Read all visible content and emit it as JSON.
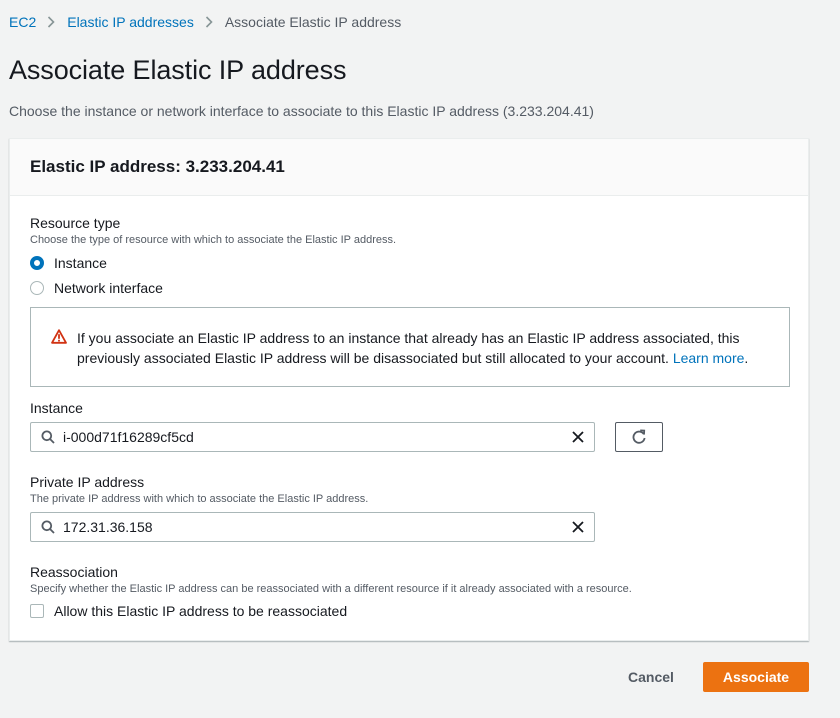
{
  "breadcrumb": {
    "items": [
      "EC2",
      "Elastic IP addresses"
    ],
    "current": "Associate Elastic IP address"
  },
  "page": {
    "title": "Associate Elastic IP address",
    "description": "Choose the instance or network interface to associate to this Elastic IP address (3.233.204.41)"
  },
  "panel": {
    "title": "Elastic IP address: 3.233.204.41"
  },
  "resource_type": {
    "label": "Resource type",
    "description": "Choose the type of resource with which to associate the Elastic IP address.",
    "options": [
      "Instance",
      "Network interface"
    ],
    "selected": "Instance"
  },
  "alert": {
    "text": "If you associate an Elastic IP address to an instance that already has an Elastic IP address associated, this previously associated Elastic IP address will be disassociated but still allocated to your account.",
    "link": "Learn more",
    "trailing": "."
  },
  "instance": {
    "label": "Instance",
    "value": "i-000d71f16289cf5cd"
  },
  "private_ip": {
    "label": "Private IP address",
    "description": "The private IP address with which to associate the Elastic IP address.",
    "value": "172.31.36.158"
  },
  "reassociation": {
    "label": "Reassociation",
    "description": "Specify whether the Elastic IP address can be reassociated with a different resource if it already associated with a resource.",
    "checkbox_label": "Allow this Elastic IP address to be reassociated",
    "checked": false
  },
  "actions": {
    "cancel": "Cancel",
    "associate": "Associate"
  },
  "colors": {
    "link": "#0073bb",
    "primary_button": "#ec7211",
    "warning_icon": "#d13212"
  },
  "icons": [
    "chevron-right-icon",
    "warning-icon",
    "search-icon",
    "close-icon",
    "refresh-icon"
  ]
}
